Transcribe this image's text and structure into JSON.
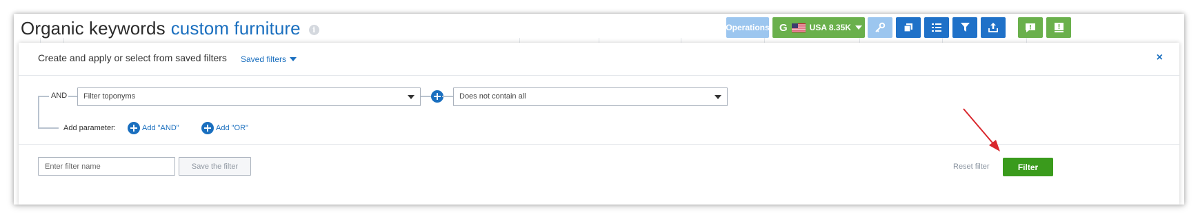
{
  "header": {
    "title": "Organic keywords",
    "query": "custom furniture",
    "info_icon": "i"
  },
  "toolbar": {
    "operations_label": "Operations",
    "country_label": "USA 8.35K",
    "icons": [
      "google-icon",
      "us-flag-icon",
      "key-icon",
      "copy-icon",
      "columns-icon",
      "filter-icon",
      "export-icon",
      "comment-icon",
      "help-icon"
    ]
  },
  "filter_panel": {
    "title": "Create and apply or select from saved filters",
    "saved_filters_label": "Saved filters",
    "close_label": "×",
    "logic_label": "AND",
    "field_select": "Filter toponyms",
    "condition_select": "Does not contain all",
    "add_parameter_label": "Add parameter:",
    "add_and_label": "Add \"AND\"",
    "add_or_label": "Add \"OR\""
  },
  "footer": {
    "filter_name_placeholder": "Enter filter name",
    "save_filter_label": "Save the filter",
    "reset_filter_label": "Reset filter",
    "filter_label": "Filter"
  },
  "colors": {
    "primary_blue": "#1a6fbf",
    "toolbar_blue": "#1f71c8",
    "light_blue": "#9cc6ef",
    "green": "#6ab04c",
    "filter_green": "#3a9b1c",
    "annotation_red": "#d9262c"
  }
}
